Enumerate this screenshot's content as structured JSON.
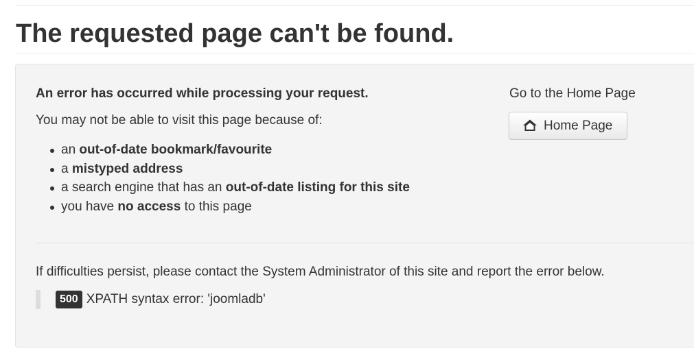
{
  "page": {
    "title": "The requested page can't be found."
  },
  "error_panel": {
    "heading": "An error has occurred while processing your request.",
    "intro": "You may not be able to visit this page because of:",
    "reasons": [
      {
        "prefix": "an ",
        "bold": "out-of-date bookmark/favourite",
        "suffix": ""
      },
      {
        "prefix": "a ",
        "bold": "mistyped address",
        "suffix": ""
      },
      {
        "prefix": "a search engine that has an ",
        "bold": "out-of-date listing for this site",
        "suffix": ""
      },
      {
        "prefix": "you have ",
        "bold": "no access",
        "suffix": " to this page"
      }
    ],
    "contact_text": "If difficulties persist, please contact the System Administrator of this site and report the error below.",
    "error_code": "500",
    "error_message": "XPATH syntax error: 'joomladb'"
  },
  "home": {
    "label": "Go to the Home Page",
    "button_label": "Home Page",
    "button_icon": "home-icon"
  },
  "colors": {
    "text": "#333333",
    "panel_background": "#f4f4f4",
    "badge_background": "#333333"
  }
}
